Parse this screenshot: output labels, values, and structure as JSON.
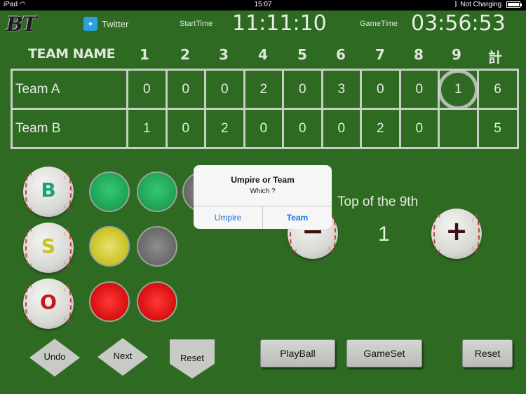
{
  "status_bar": {
    "device": "iPad",
    "time": "15:07",
    "battery_status": "Not Charging"
  },
  "header": {
    "logo": "BT",
    "twitter_label": "Twitter",
    "start_time_label": "StartTime",
    "start_time": "11:11:10",
    "game_time_label": "GameTime",
    "game_time": "03:56:53"
  },
  "scoreboard": {
    "team_name_header": "TEAM NAME",
    "innings": [
      "1",
      "2",
      "3",
      "4",
      "5",
      "6",
      "7",
      "8",
      "9"
    ],
    "total_header": "計",
    "current_inning_index": 8,
    "rows": [
      {
        "team": "Team A",
        "scores": [
          "0",
          "0",
          "0",
          "2",
          "0",
          "3",
          "0",
          "0",
          "1"
        ],
        "total": "6"
      },
      {
        "team": "Team B",
        "scores": [
          "1",
          "0",
          "2",
          "0",
          "0",
          "0",
          "2",
          "0",
          ""
        ],
        "total": "5"
      }
    ]
  },
  "count_panel": {
    "ball_letter": "B",
    "strike_letter": "S",
    "out_letter": "O",
    "balls_lit": 2,
    "strikes_lit": 1,
    "outs_lit": 2,
    "colors": {
      "ball": "#1da055",
      "strike": "#cfc62c",
      "out": "#dd1414",
      "off": "#6d6d6d"
    }
  },
  "inning_control": {
    "half_label": "Top of the 9th",
    "value": "1",
    "minus_sign": "−",
    "plus_sign": "+"
  },
  "buttons": {
    "undo": "Undo",
    "next": "Next",
    "reset_count": "Reset",
    "play_ball": "PlayBall",
    "game_set": "GameSet",
    "reset": "Reset"
  },
  "dialog": {
    "title": "Umpire or Team",
    "message": "Which ?",
    "option_umpire": "Umpire",
    "option_team": "Team"
  },
  "icons": {
    "wifi": "wifi-icon",
    "bluetooth": "bluetooth-icon",
    "battery": "battery-icon",
    "twitter": "twitter-icon"
  }
}
